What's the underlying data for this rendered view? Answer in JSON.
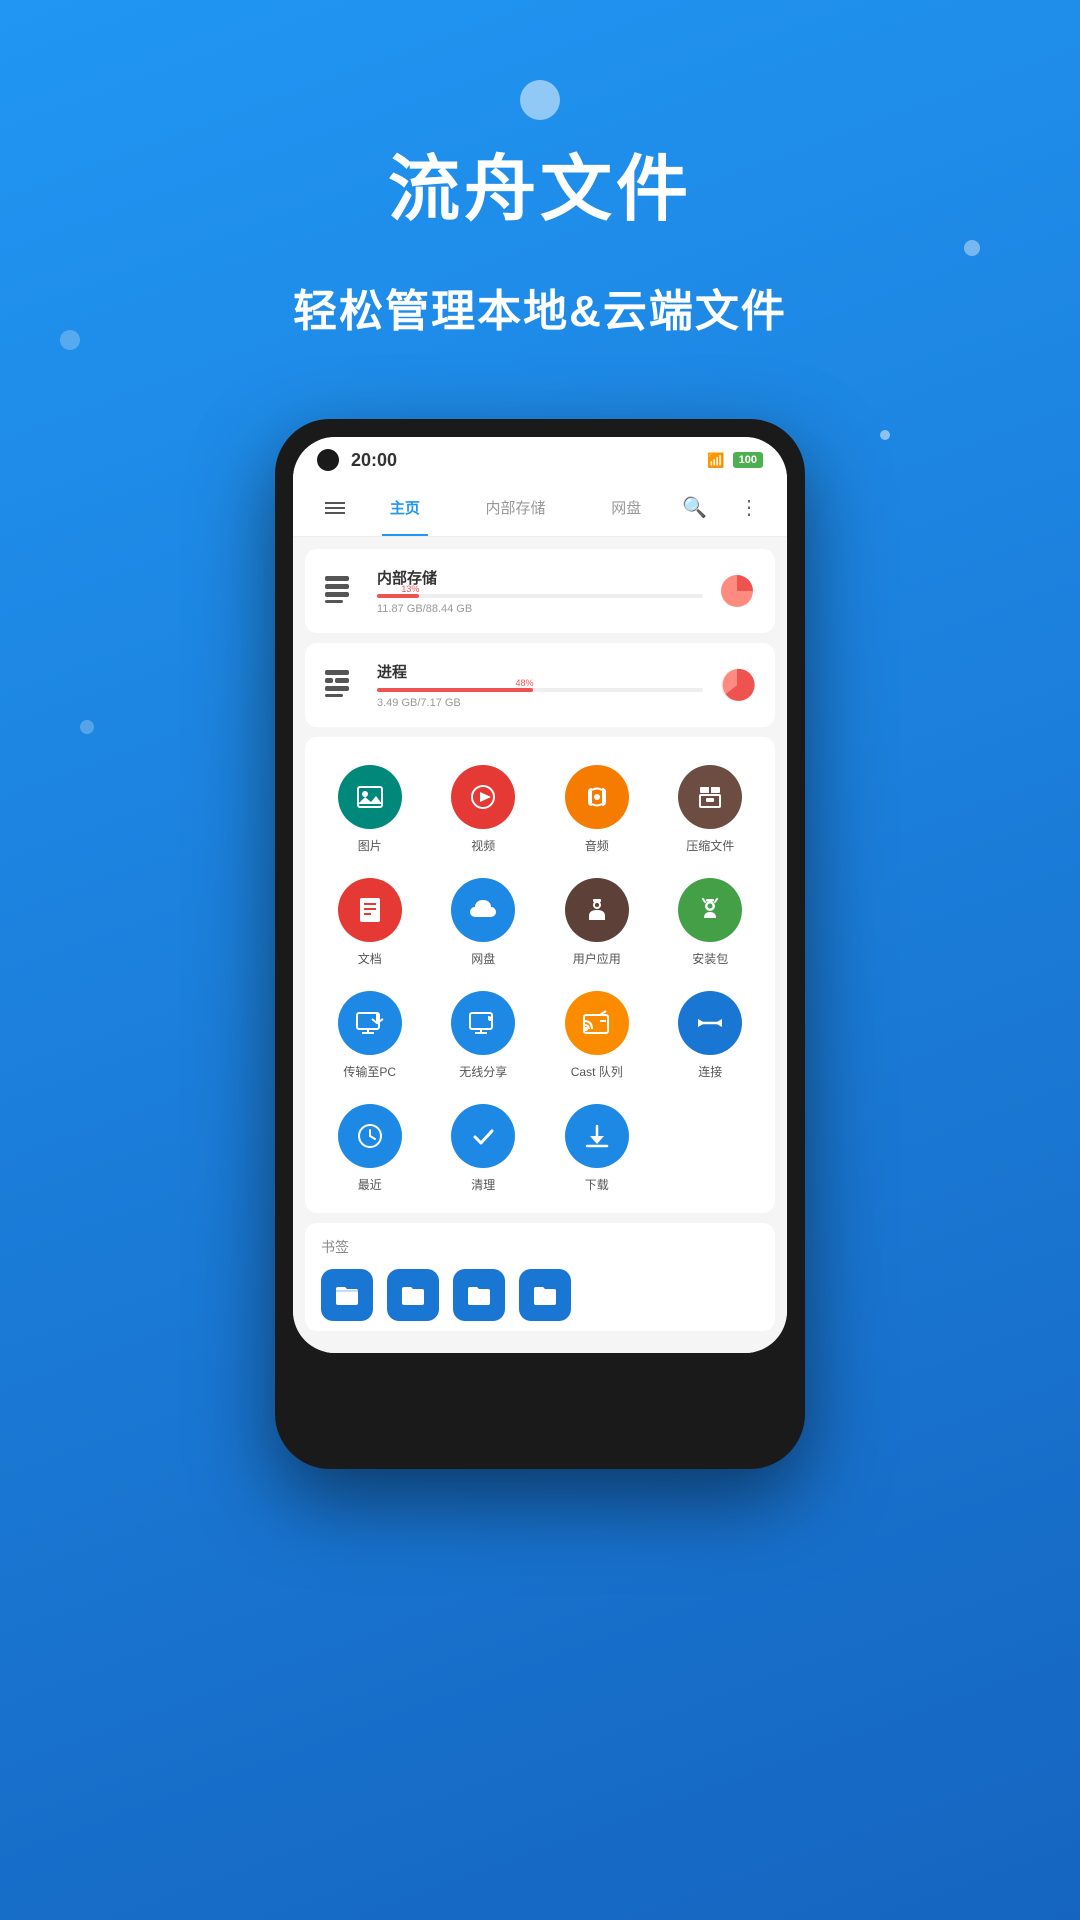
{
  "app": {
    "title": "流舟文件",
    "subtitle": "轻松管理本地&云端文件"
  },
  "phone": {
    "statusBar": {
      "time": "20:00",
      "wifi": "WiFi",
      "battery": "100"
    },
    "nav": {
      "tabs": [
        {
          "id": "home",
          "label": "主页",
          "active": true
        },
        {
          "id": "internal",
          "label": "内部存储",
          "active": false
        },
        {
          "id": "cloud",
          "label": "网盘",
          "active": false
        }
      ]
    },
    "storage": [
      {
        "name": "内部存储",
        "percent": 13,
        "percentLabel": "13%",
        "size": "11.87 GB/88.44 GB"
      },
      {
        "name": "进程",
        "percent": 48,
        "percentLabel": "48%",
        "size": "3.49 GB/7.17 GB"
      }
    ],
    "icons": [
      {
        "id": "photos",
        "label": "图片",
        "color": "teal",
        "icon": "🖼"
      },
      {
        "id": "video",
        "label": "视频",
        "color": "red",
        "icon": "▶"
      },
      {
        "id": "audio",
        "label": "音频",
        "color": "orange",
        "icon": "🎧"
      },
      {
        "id": "archive",
        "label": "压缩文件",
        "color": "brown",
        "icon": "📦"
      },
      {
        "id": "docs",
        "label": "文档",
        "color": "red2",
        "icon": "📄"
      },
      {
        "id": "netdisk",
        "label": "网盘",
        "color": "blue",
        "icon": "☁"
      },
      {
        "id": "apps",
        "label": "用户应用",
        "color": "darkbrown",
        "icon": "🤖"
      },
      {
        "id": "apk",
        "label": "安装包",
        "color": "green",
        "icon": "🤖"
      },
      {
        "id": "transfer",
        "label": "传输至PC",
        "color": "blue2",
        "icon": "🖥"
      },
      {
        "id": "wireless",
        "label": "无线分享",
        "color": "blue3",
        "icon": "🖥"
      },
      {
        "id": "cast",
        "label": "Cast 队列",
        "color": "orange2",
        "icon": "📡"
      },
      {
        "id": "connect",
        "label": "连接",
        "color": "blue4",
        "icon": "↔"
      },
      {
        "id": "recent",
        "label": "最近",
        "color": "blue5",
        "icon": "🕐"
      },
      {
        "id": "clean",
        "label": "清理",
        "color": "blue6",
        "icon": "✔"
      },
      {
        "id": "download",
        "label": "下载",
        "color": "blue7",
        "icon": "⬇"
      }
    ],
    "bookmarks": {
      "title": "书签",
      "folders": [
        {
          "id": "f1",
          "color": "#1976D2"
        },
        {
          "id": "f2",
          "color": "#1976D2"
        },
        {
          "id": "f3",
          "color": "#1976D2"
        },
        {
          "id": "f4",
          "color": "#1976D2"
        }
      ]
    }
  }
}
